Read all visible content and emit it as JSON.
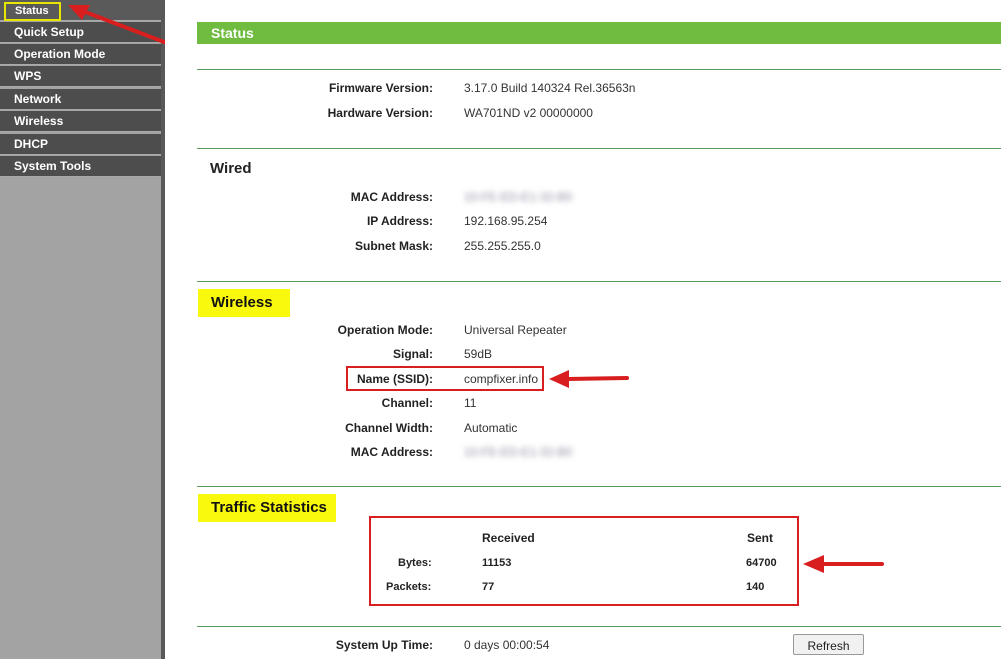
{
  "sidebar": {
    "items": [
      {
        "label": "Status"
      },
      {
        "label": "Quick Setup"
      },
      {
        "label": "Operation Mode"
      },
      {
        "label": "WPS"
      },
      {
        "label": "Network"
      },
      {
        "label": "Wireless"
      },
      {
        "label": "DHCP"
      },
      {
        "label": "System Tools"
      }
    ]
  },
  "page": {
    "title": "Status"
  },
  "info": {
    "firmware_label": "Firmware Version:",
    "firmware_value": "3.17.0 Build 140324 Rel.36563n",
    "hardware_label": "Hardware Version:",
    "hardware_value": "WA701ND v2 00000000"
  },
  "wired": {
    "title": "Wired",
    "mac_label": "MAC Address:",
    "mac_value": "10-FE-ED-E1-32-B0",
    "ip_label": "IP Address:",
    "ip_value": "192.168.95.254",
    "subnet_label": "Subnet Mask:",
    "subnet_value": "255.255.255.0"
  },
  "wireless": {
    "title": "Wireless",
    "mode_label": "Operation Mode:",
    "mode_value": "Universal Repeater",
    "signal_label": "Signal:",
    "signal_value": "59dB",
    "ssid_label": "Name (SSID):",
    "ssid_value": "compfixer.info",
    "channel_label": "Channel:",
    "channel_value": "11",
    "width_label": "Channel Width:",
    "width_value": "Automatic",
    "mac_label": "MAC Address:",
    "mac_value": "10-FE-ED-E1-32-B0"
  },
  "traffic": {
    "title": "Traffic Statistics",
    "received_header": "Received",
    "sent_header": "Sent",
    "bytes_label": "Bytes:",
    "bytes_received": "11153",
    "bytes_sent": "64700",
    "packets_label": "Packets:",
    "packets_received": "77",
    "packets_sent": "140"
  },
  "uptime": {
    "label": "System Up Time:",
    "value": "0 days 00:00:54",
    "refresh_label": "Refresh"
  },
  "colors": {
    "accent_green": "#6fbc41",
    "highlight_yellow": "#f9f90e",
    "annotation_red": "#d81e1e"
  }
}
